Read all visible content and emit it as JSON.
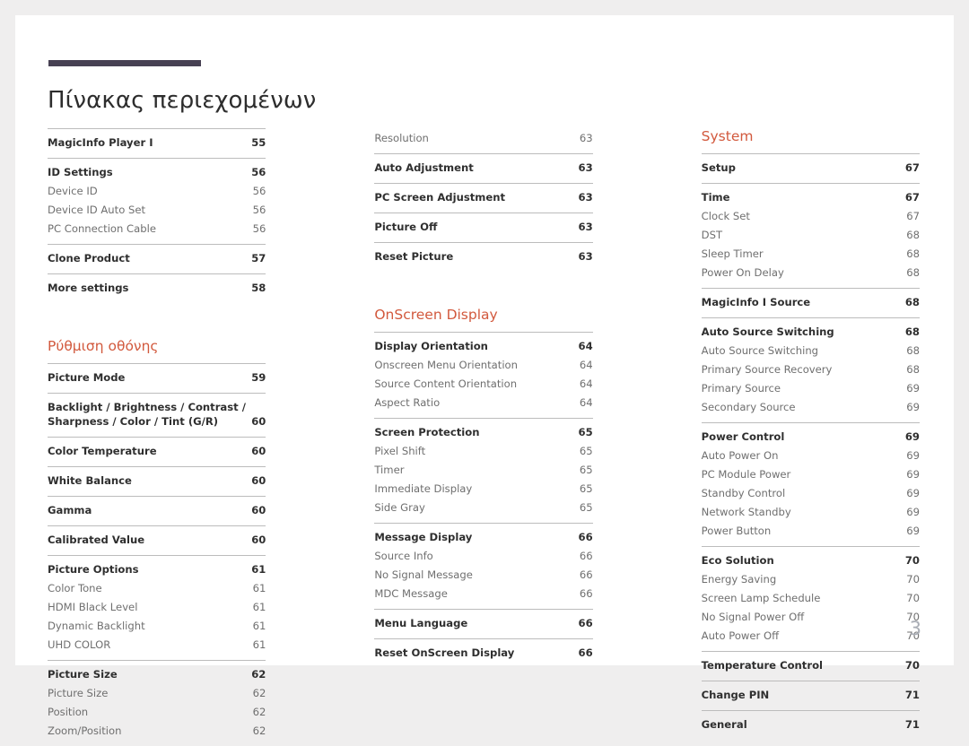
{
  "document": {
    "title": "Πίνακας περιεχομένων",
    "folio": "3"
  },
  "colors": {
    "accent_bar": "#474153",
    "section_heading": "#d2593d",
    "rule": "#bcbcbc",
    "head_text": "#2f2f2f",
    "sub_text": "#6f6f6f",
    "folio_text": "#a9adb5",
    "page_background": "#ffffff",
    "canvas_background": "#efeeee"
  },
  "columns": [
    {
      "blocks": [
        {
          "type": "group",
          "rule": true,
          "rows": [
            {
              "label": "MagicInfo Player I",
              "page": "55",
              "level": "head"
            }
          ]
        },
        {
          "type": "group",
          "rule": true,
          "rows": [
            {
              "label": "ID Settings",
              "page": "56",
              "level": "head"
            },
            {
              "label": "Device ID",
              "page": "56",
              "level": "sub"
            },
            {
              "label": "Device ID Auto Set",
              "page": "56",
              "level": "sub"
            },
            {
              "label": "PC Connection Cable",
              "page": "56",
              "level": "sub"
            }
          ]
        },
        {
          "type": "group",
          "rule": true,
          "rows": [
            {
              "label": "Clone Product",
              "page": "57",
              "level": "head"
            }
          ]
        },
        {
          "type": "group",
          "rule": true,
          "rows": [
            {
              "label": "More settings",
              "page": "58",
              "level": "head"
            }
          ]
        },
        {
          "type": "gap"
        },
        {
          "type": "heading",
          "label": "Ρύθμιση οθόνης"
        },
        {
          "type": "group",
          "rule": true,
          "rows": [
            {
              "label": "Picture Mode",
              "page": "59",
              "level": "head"
            }
          ]
        },
        {
          "type": "group",
          "rule": true,
          "rows": [
            {
              "label": "Backlight / Brightness / Contrast /\nSharpness / Color / Tint (G/R)",
              "page": "60",
              "level": "head"
            }
          ]
        },
        {
          "type": "group",
          "rule": true,
          "rows": [
            {
              "label": "Color Temperature",
              "page": "60",
              "level": "head"
            }
          ]
        },
        {
          "type": "group",
          "rule": true,
          "rows": [
            {
              "label": "White Balance",
              "page": "60",
              "level": "head"
            }
          ]
        },
        {
          "type": "group",
          "rule": true,
          "rows": [
            {
              "label": "Gamma",
              "page": "60",
              "level": "head"
            }
          ]
        },
        {
          "type": "group",
          "rule": true,
          "rows": [
            {
              "label": "Calibrated Value",
              "page": "60",
              "level": "head"
            }
          ]
        },
        {
          "type": "group",
          "rule": true,
          "rows": [
            {
              "label": "Picture Options",
              "page": "61",
              "level": "head"
            },
            {
              "label": "Color Tone",
              "page": "61",
              "level": "sub"
            },
            {
              "label": "HDMI Black Level",
              "page": "61",
              "level": "sub"
            },
            {
              "label": "Dynamic Backlight",
              "page": "61",
              "level": "sub"
            },
            {
              "label": "UHD COLOR",
              "page": "61",
              "level": "sub"
            }
          ]
        },
        {
          "type": "group",
          "rule": true,
          "rows": [
            {
              "label": "Picture Size",
              "page": "62",
              "level": "head"
            },
            {
              "label": "Picture Size",
              "page": "62",
              "level": "sub"
            },
            {
              "label": "Position",
              "page": "62",
              "level": "sub"
            },
            {
              "label": "Zoom/Position",
              "page": "62",
              "level": "sub"
            }
          ]
        }
      ]
    },
    {
      "blocks": [
        {
          "type": "group",
          "rule": false,
          "rows": [
            {
              "label": "Resolution",
              "page": "63",
              "level": "sub"
            }
          ]
        },
        {
          "type": "group",
          "rule": true,
          "rows": [
            {
              "label": "Auto Adjustment",
              "page": "63",
              "level": "head"
            }
          ]
        },
        {
          "type": "group",
          "rule": true,
          "rows": [
            {
              "label": "PC Screen Adjustment",
              "page": "63",
              "level": "head"
            }
          ]
        },
        {
          "type": "group",
          "rule": true,
          "rows": [
            {
              "label": "Picture Off",
              "page": "63",
              "level": "head"
            }
          ]
        },
        {
          "type": "group",
          "rule": true,
          "rows": [
            {
              "label": "Reset Picture",
              "page": "63",
              "level": "head"
            }
          ]
        },
        {
          "type": "gap"
        },
        {
          "type": "heading",
          "label": "OnScreen Display"
        },
        {
          "type": "group",
          "rule": true,
          "rows": [
            {
              "label": "Display Orientation",
              "page": "64",
              "level": "head"
            },
            {
              "label": "Onscreen Menu Orientation",
              "page": "64",
              "level": "sub"
            },
            {
              "label": "Source Content Orientation",
              "page": "64",
              "level": "sub"
            },
            {
              "label": "Aspect Ratio",
              "page": "64",
              "level": "sub"
            }
          ]
        },
        {
          "type": "group",
          "rule": true,
          "rows": [
            {
              "label": "Screen Protection",
              "page": "65",
              "level": "head"
            },
            {
              "label": "Pixel Shift",
              "page": "65",
              "level": "sub"
            },
            {
              "label": "Timer",
              "page": "65",
              "level": "sub"
            },
            {
              "label": "Immediate Display",
              "page": "65",
              "level": "sub"
            },
            {
              "label": "Side Gray",
              "page": "65",
              "level": "sub"
            }
          ]
        },
        {
          "type": "group",
          "rule": true,
          "rows": [
            {
              "label": "Message Display",
              "page": "66",
              "level": "head"
            },
            {
              "label": "Source Info",
              "page": "66",
              "level": "sub"
            },
            {
              "label": "No Signal Message",
              "page": "66",
              "level": "sub"
            },
            {
              "label": "MDC Message",
              "page": "66",
              "level": "sub"
            }
          ]
        },
        {
          "type": "group",
          "rule": true,
          "rows": [
            {
              "label": "Menu Language",
              "page": "66",
              "level": "head"
            }
          ]
        },
        {
          "type": "group",
          "rule": true,
          "rows": [
            {
              "label": "Reset OnScreen Display",
              "page": "66",
              "level": "head"
            }
          ]
        }
      ]
    },
    {
      "blocks": [
        {
          "type": "heading",
          "label": "System"
        },
        {
          "type": "group",
          "rule": true,
          "rows": [
            {
              "label": "Setup",
              "page": "67",
              "level": "head"
            }
          ]
        },
        {
          "type": "group",
          "rule": true,
          "rows": [
            {
              "label": "Time",
              "page": "67",
              "level": "head"
            },
            {
              "label": "Clock Set",
              "page": "67",
              "level": "sub"
            },
            {
              "label": "DST",
              "page": "68",
              "level": "sub"
            },
            {
              "label": "Sleep Timer",
              "page": "68",
              "level": "sub"
            },
            {
              "label": "Power On Delay",
              "page": "68",
              "level": "sub"
            }
          ]
        },
        {
          "type": "group",
          "rule": true,
          "rows": [
            {
              "label": "MagicInfo I Source",
              "page": "68",
              "level": "head"
            }
          ]
        },
        {
          "type": "group",
          "rule": true,
          "rows": [
            {
              "label": "Auto Source Switching",
              "page": "68",
              "level": "head"
            },
            {
              "label": "Auto Source Switching",
              "page": "68",
              "level": "sub"
            },
            {
              "label": "Primary Source Recovery",
              "page": "68",
              "level": "sub"
            },
            {
              "label": "Primary Source",
              "page": "69",
              "level": "sub"
            },
            {
              "label": "Secondary Source",
              "page": "69",
              "level": "sub"
            }
          ]
        },
        {
          "type": "group",
          "rule": true,
          "rows": [
            {
              "label": "Power Control",
              "page": "69",
              "level": "head"
            },
            {
              "label": "Auto Power On",
              "page": "69",
              "level": "sub"
            },
            {
              "label": "PC Module Power",
              "page": "69",
              "level": "sub"
            },
            {
              "label": "Standby Control",
              "page": "69",
              "level": "sub"
            },
            {
              "label": "Network Standby",
              "page": "69",
              "level": "sub"
            },
            {
              "label": "Power Button",
              "page": "69",
              "level": "sub"
            }
          ]
        },
        {
          "type": "group",
          "rule": true,
          "rows": [
            {
              "label": "Eco Solution",
              "page": "70",
              "level": "head"
            },
            {
              "label": "Energy Saving",
              "page": "70",
              "level": "sub"
            },
            {
              "label": "Screen Lamp Schedule",
              "page": "70",
              "level": "sub"
            },
            {
              "label": "No Signal Power Off",
              "page": "70",
              "level": "sub"
            },
            {
              "label": "Auto Power Off",
              "page": "70",
              "level": "sub"
            }
          ]
        },
        {
          "type": "group",
          "rule": true,
          "rows": [
            {
              "label": "Temperature Control",
              "page": "70",
              "level": "head"
            }
          ]
        },
        {
          "type": "group",
          "rule": true,
          "rows": [
            {
              "label": "Change PIN",
              "page": "71",
              "level": "head"
            }
          ]
        },
        {
          "type": "group",
          "rule": true,
          "rows": [
            {
              "label": "General",
              "page": "71",
              "level": "head"
            }
          ]
        }
      ]
    }
  ]
}
